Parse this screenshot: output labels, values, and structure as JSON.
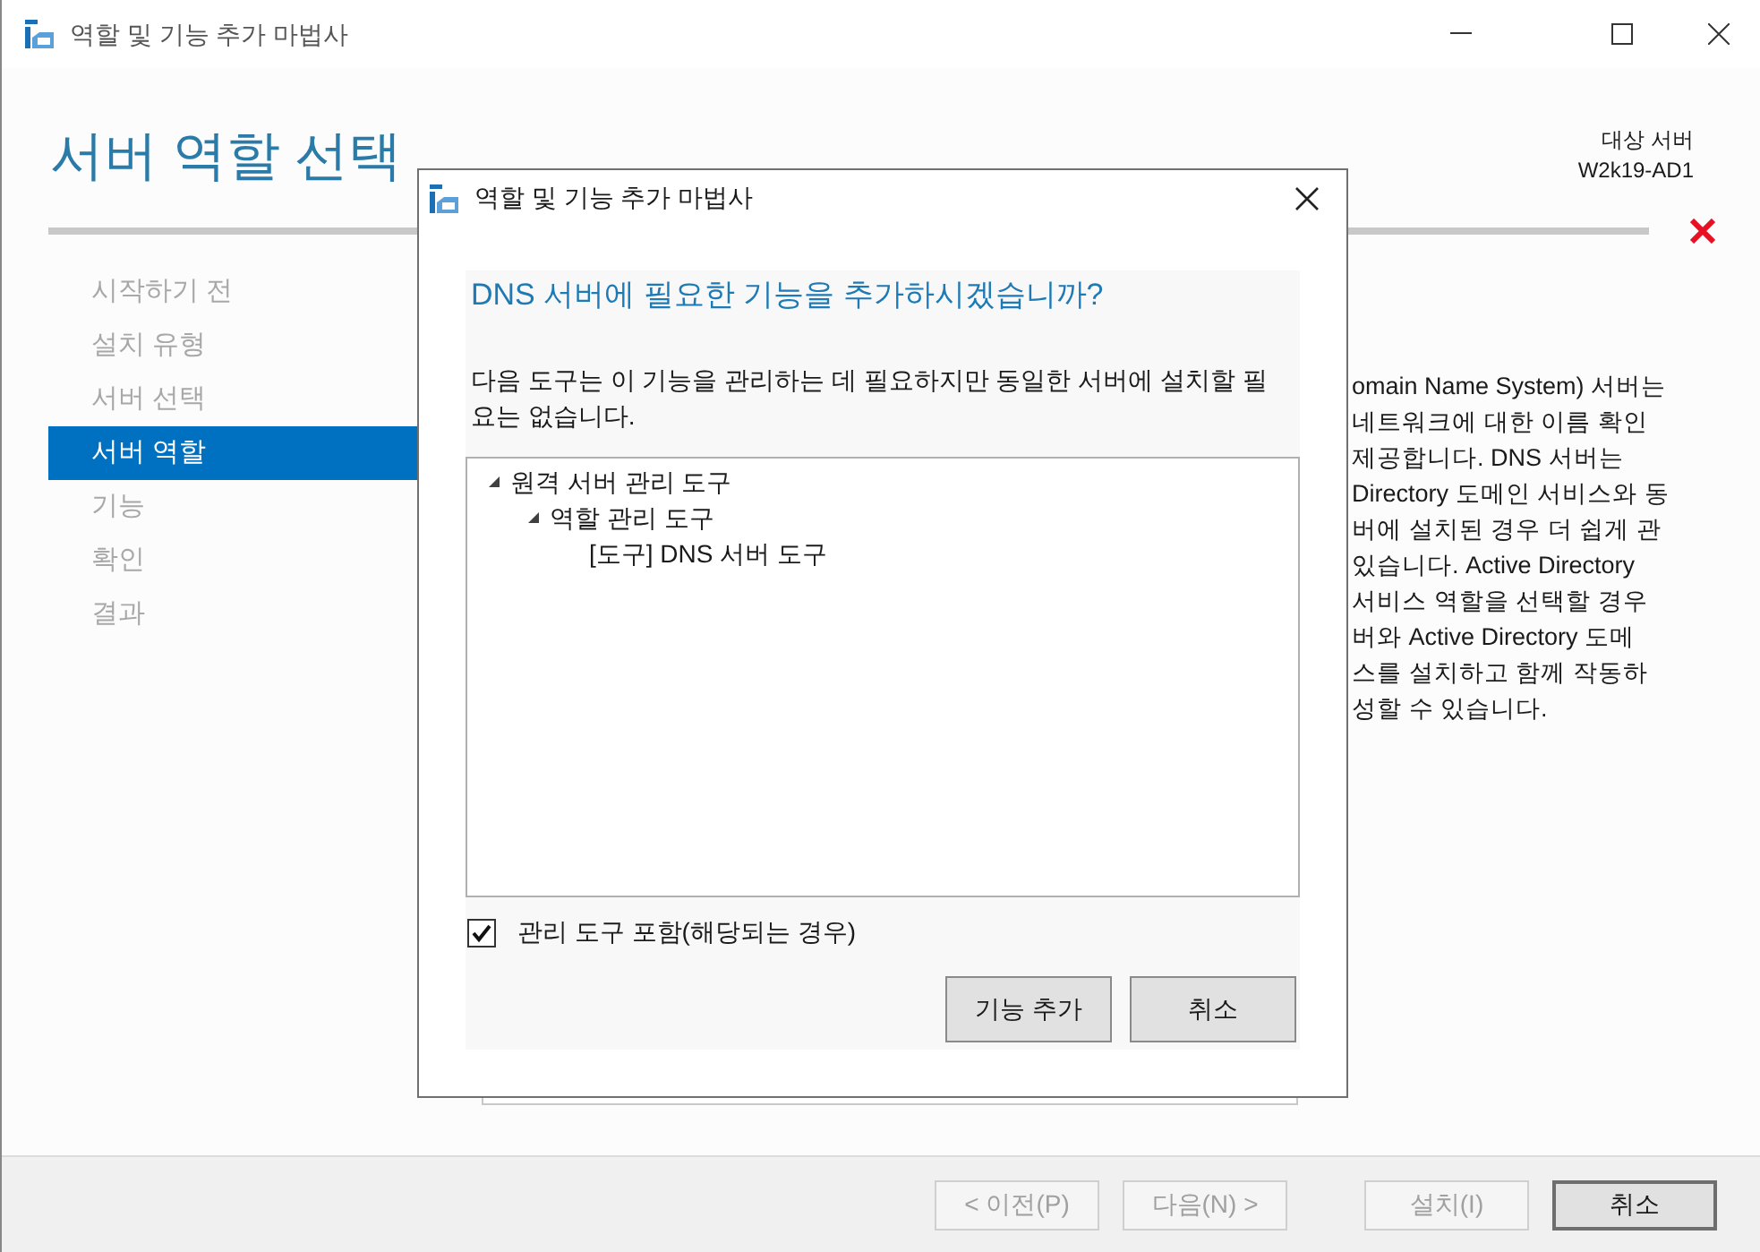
{
  "window": {
    "title": "역할 및 기능 추가 마법사"
  },
  "header": {
    "title": "서버 역할 선택",
    "target_label": "대상 서버",
    "target_server": "W2k19-AD1"
  },
  "nav": [
    {
      "label": "시작하기 전",
      "selected": false
    },
    {
      "label": "설치 유형",
      "selected": false
    },
    {
      "label": "서버 선택",
      "selected": false
    },
    {
      "label": "서버 역할",
      "selected": true
    },
    {
      "label": "기능",
      "selected": false
    },
    {
      "label": "확인",
      "selected": false
    },
    {
      "label": "결과",
      "selected": false
    }
  ],
  "description_lines": [
    "omain Name System) 서버는",
    "네트워크에 대한 이름 확인",
    "제공합니다. DNS 서버는",
    "Directory 도메인 서비스와 동",
    "버에 설치된 경우 더 쉽게 관",
    "있습니다. Active Directory",
    "서비스 역할을 선택할 경우",
    "버와 Active Directory 도메",
    "스를 설치하고 함께 작동하",
    "성할 수 있습니다."
  ],
  "footer_buttons": [
    {
      "label": "< 이전(P)",
      "disabled": true,
      "default": false
    },
    {
      "label": "다음(N) >",
      "disabled": true,
      "default": false
    },
    {
      "label": "설치(I)",
      "disabled": true,
      "default": false
    },
    {
      "label": "취소",
      "disabled": false,
      "default": true
    }
  ],
  "dialog": {
    "title": "역할 및 기능 추가 마법사",
    "heading": "DNS 서버에 필요한 기능을 추가하시겠습니까?",
    "message": "다음 도구는 이 기능을 관리하는 데 필요하지만 동일한 서버에 설치할 필요는 없습니다.",
    "tree": [
      {
        "label": "원격 서버 관리 도구",
        "expanded": true,
        "children": [
          {
            "label": "역할 관리 도구",
            "expanded": true,
            "children": [
              {
                "label": "[도구] DNS 서버 도구"
              }
            ]
          }
        ]
      }
    ],
    "checkbox": {
      "label": "관리 도구 포함(해당되는 경우)",
      "checked": true
    },
    "buttons": [
      "기능 추가",
      "취소"
    ]
  }
}
